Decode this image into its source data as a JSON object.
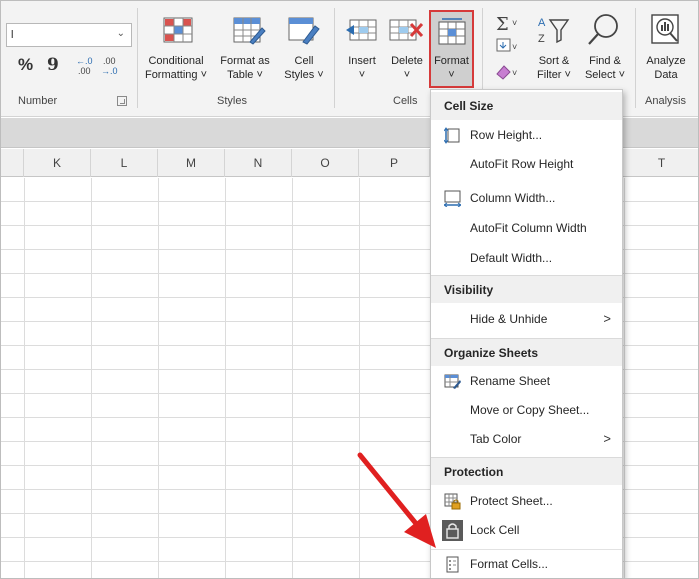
{
  "ribbon": {
    "number_group": {
      "combo_value": "l",
      "percent_symbol": "%",
      "comma_symbol": "9",
      "increase_decimal": "←.0\n.00",
      "decrease_decimal": ".00\n→.0",
      "label": "Number"
    },
    "styles_group": {
      "conditional_formatting": [
        "Conditional",
        "Formatting ˅"
      ],
      "format_as_table": [
        "Format as",
        "Table ˅"
      ],
      "cell_styles": [
        "Cell",
        "Styles ˅"
      ],
      "label": "Styles"
    },
    "cells_group": {
      "insert": [
        "Insert",
        "˅"
      ],
      "delete": [
        "Delete",
        "˅"
      ],
      "format": [
        "Format",
        "˅"
      ],
      "label": "Cells"
    },
    "editing_group": {
      "sort_filter": [
        "Sort &",
        "Filter ˅"
      ],
      "find_select": [
        "Find &",
        "Select ˅"
      ]
    },
    "analysis_group": {
      "analyze_data": [
        "Analyze",
        "Data"
      ],
      "label": "Analysis"
    }
  },
  "columns": [
    "K",
    "L",
    "M",
    "N",
    "O",
    "P",
    "T"
  ],
  "menu": {
    "sections": [
      {
        "title": "Cell Size"
      },
      {
        "title": "Visibility"
      },
      {
        "title": "Organize Sheets"
      },
      {
        "title": "Protection"
      }
    ],
    "items": {
      "row_height": "Row Height...",
      "autofit_row_height": "AutoFit Row Height",
      "column_width": "Column Width...",
      "autofit_column_width": "AutoFit Column Width",
      "default_width": "Default Width...",
      "hide_unhide": "Hide & Unhide",
      "rename_sheet": "Rename Sheet",
      "move_copy_sheet": "Move or Copy Sheet...",
      "tab_color": "Tab Color",
      "protect_sheet": "Protect Sheet...",
      "lock_cell": "Lock Cell",
      "format_cells": "Format Cells..."
    },
    "submenu_arrow": ">"
  },
  "colors": {
    "highlight_border": "#d63a3a",
    "annotation_arrow": "#e02020",
    "section_bg": "#f0f0f0"
  }
}
